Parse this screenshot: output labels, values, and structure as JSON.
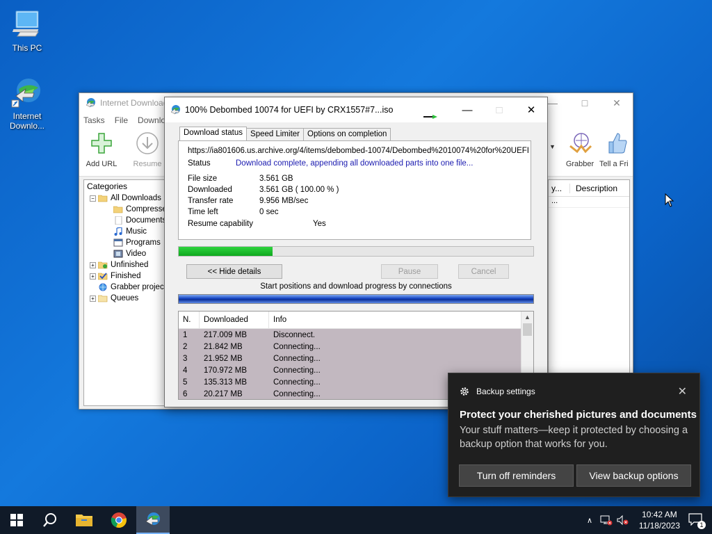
{
  "desktop": {
    "icons": [
      {
        "label": "This PC"
      },
      {
        "label": "Internet Downlo..."
      }
    ]
  },
  "main_window": {
    "title": "Internet Download",
    "menu": [
      "Tasks",
      "File",
      "Downlo"
    ],
    "toolbar": {
      "add_url": "Add URL",
      "resume": "Resume",
      "grabber": "Grabber",
      "tell_friend": "Tell a Fri"
    },
    "categories_title": "Categories",
    "tree": [
      {
        "label": "All Downloads",
        "level": 0,
        "expanded": true
      },
      {
        "label": "Compresse",
        "level": 1
      },
      {
        "label": "Documents",
        "level": 1
      },
      {
        "label": "Music",
        "level": 1
      },
      {
        "label": "Programs",
        "level": 1
      },
      {
        "label": "Video",
        "level": 1
      },
      {
        "label": "Unfinished",
        "level": 0
      },
      {
        "label": "Finished",
        "level": 0
      },
      {
        "label": "Grabber projec",
        "level": 0
      },
      {
        "label": "Queues",
        "level": 0
      }
    ],
    "list_header": {
      "col_partial": "y...",
      "description": "Description"
    },
    "list_cell_partial": "..."
  },
  "download_dialog": {
    "title": "100% Debombed 10074 for UEFI by CRX1557#7...iso",
    "tabs": [
      "Download status",
      "Speed Limiter",
      "Options on completion"
    ],
    "url": "https://ia801606.us.archive.org/4/items/debombed-10074/Debombed%2010074%20for%20UEFI%",
    "status_label": "Status",
    "status_value": "Download complete, appending all downloaded parts into one file...",
    "file_size_label": "File size",
    "file_size_value": "3.561  GB",
    "downloaded_label": "Downloaded",
    "downloaded_value": "3.561  GB  ( 100.00 % )",
    "transfer_rate_label": "Transfer rate",
    "transfer_rate_value": "9.956  MB/sec",
    "time_left_label": "Time left",
    "time_left_value": "0 sec",
    "resume_label": "Resume capability",
    "resume_value": "Yes",
    "progress_fraction": 0.265,
    "hide_details": "<< Hide details",
    "pause": "Pause",
    "cancel": "Cancel",
    "connections_label": "Start positions and download progress by connections",
    "table_headers": [
      "N.",
      "Downloaded",
      "Info"
    ],
    "connections": [
      {
        "n": "1",
        "downloaded": "217.009  MB",
        "info": "Disconnect."
      },
      {
        "n": "2",
        "downloaded": "21.842  MB",
        "info": "Connecting..."
      },
      {
        "n": "3",
        "downloaded": "21.952  MB",
        "info": "Connecting..."
      },
      {
        "n": "4",
        "downloaded": "170.972  MB",
        "info": "Connecting..."
      },
      {
        "n": "5",
        "downloaded": "135.313  MB",
        "info": "Connecting..."
      },
      {
        "n": "6",
        "downloaded": "20.217  MB",
        "info": "Connecting..."
      }
    ]
  },
  "toast": {
    "app": "Backup settings",
    "title": "Protect your cherished pictures and documents",
    "body": "Your stuff matters—keep it protected by choosing a backup option that works for you.",
    "btn_off": "Turn off reminders",
    "btn_view": "View backup options"
  },
  "taskbar": {
    "time": "10:42 AM",
    "date": "11/18/2023",
    "notification_count": "1"
  },
  "colors": {
    "desktop": "#0a5fc4",
    "status_text": "#1b1bb0",
    "progress_fill": "#18b82a",
    "toast_bg": "#1f1f1f",
    "taskbar": "#101a28"
  }
}
